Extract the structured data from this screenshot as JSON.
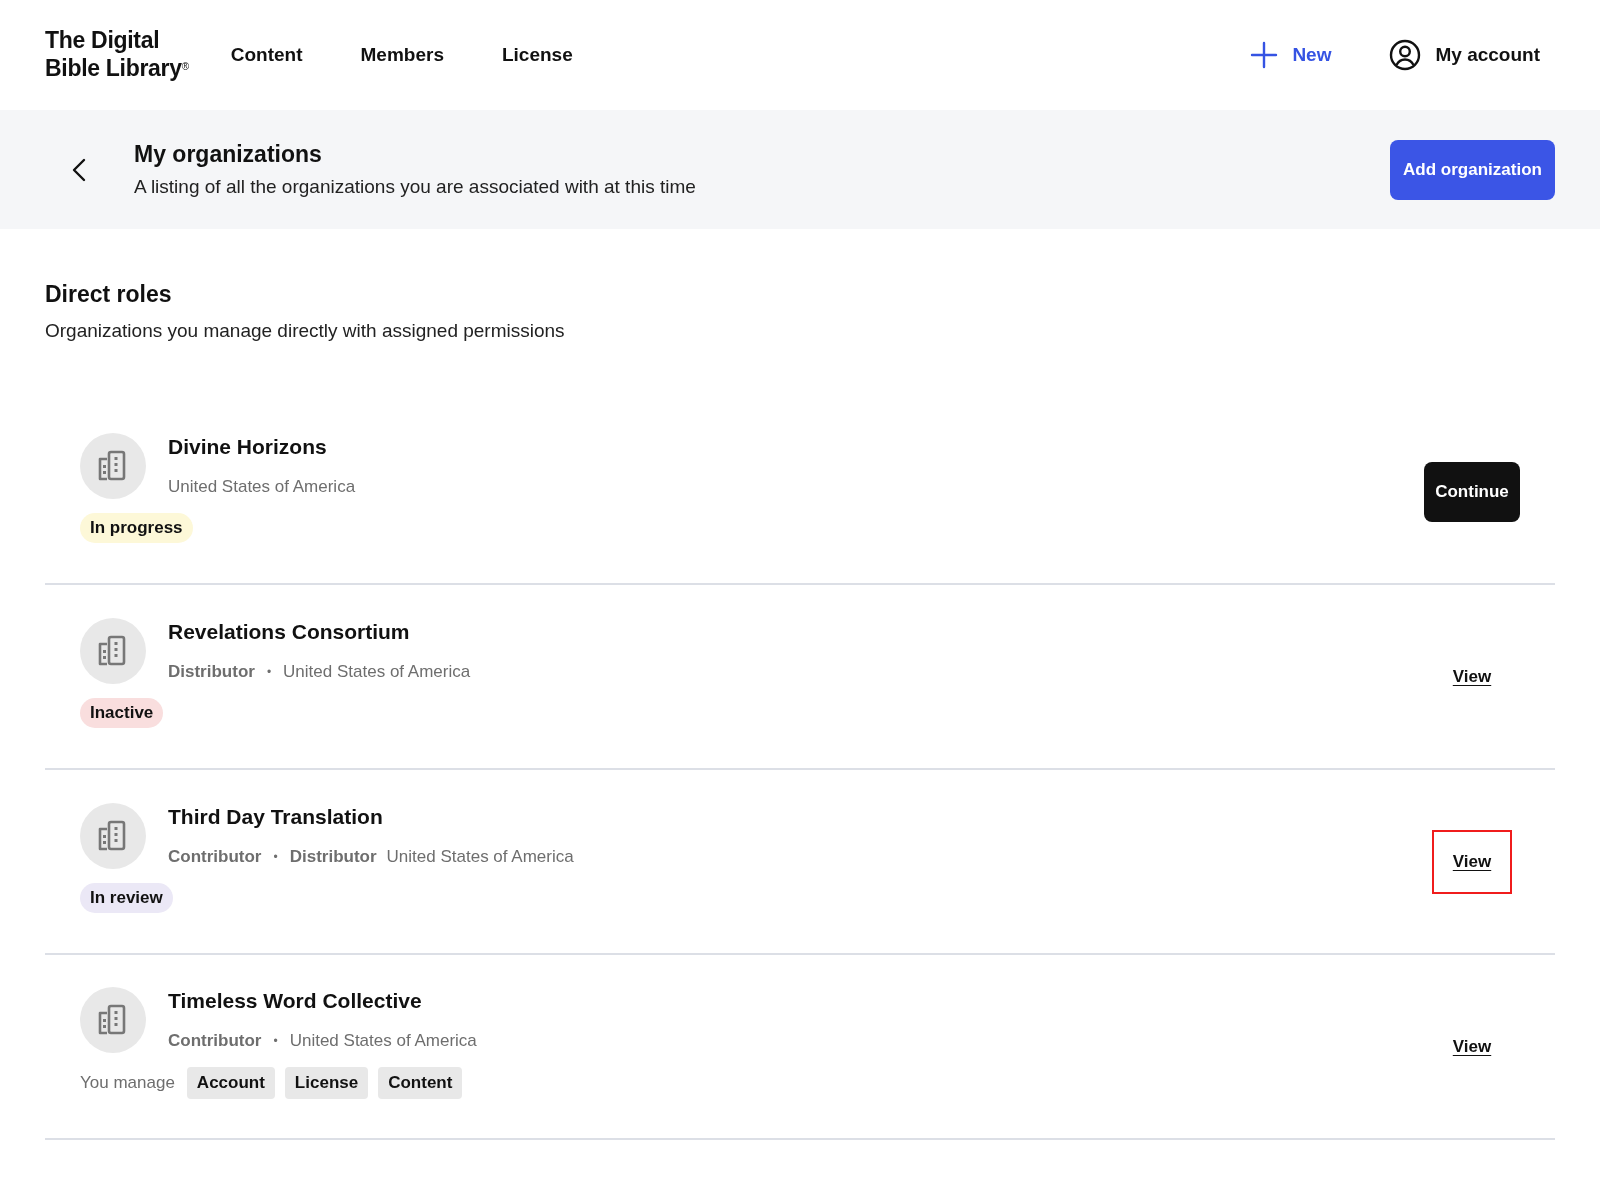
{
  "header": {
    "logo": {
      "line_1": "The Digital",
      "line_2": "Bible Library",
      "mark": "®"
    },
    "nav": [
      {
        "label": "Content"
      },
      {
        "label": "Members"
      },
      {
        "label": "License"
      }
    ],
    "new_button": {
      "label": "New"
    },
    "account_button": {
      "label": "My account"
    }
  },
  "banner": {
    "title": "My organizations",
    "subtitle": "A listing of all the organizations you are associated with at this time",
    "action": {
      "label": "Add organization"
    }
  },
  "section": {
    "title": "Direct roles",
    "subtitle": "Organizations you manage directly with assigned permissions",
    "organizations": [
      {
        "name": "Divine Horizons",
        "meta": [
          {
            "kind": "country",
            "text": "United States of America"
          }
        ],
        "status": {
          "label": "In progress",
          "color": "#fdf8d8"
        },
        "action": {
          "kind": "button",
          "label": "Continue",
          "highlighted": false
        }
      },
      {
        "name": "Revelations Consortium",
        "meta": [
          {
            "kind": "role",
            "text": "Distributor"
          },
          {
            "kind": "separator",
            "text": "•"
          },
          {
            "kind": "country",
            "text": "United States of America"
          }
        ],
        "status": {
          "label": "Inactive",
          "color": "#f9dede"
        },
        "action": {
          "kind": "link",
          "label": "View",
          "highlighted": false
        }
      },
      {
        "name": "Third Day Translation",
        "meta": [
          {
            "kind": "role",
            "text": "Contributor"
          },
          {
            "kind": "separator",
            "text": "•"
          },
          {
            "kind": "role",
            "text": "Distributor"
          },
          {
            "kind": "country",
            "text": "United States of America"
          }
        ],
        "status": {
          "label": "In review",
          "color": "#ebe8f6"
        },
        "action": {
          "kind": "link",
          "label": "View",
          "highlighted": true
        }
      },
      {
        "name": "Timeless Word Collective",
        "meta": [
          {
            "kind": "role",
            "text": "Contributor"
          },
          {
            "kind": "separator",
            "text": "•"
          },
          {
            "kind": "country",
            "text": "United States of America"
          }
        ],
        "manage": {
          "label": "You manage",
          "items": [
            {
              "label": "Account"
            },
            {
              "label": "License"
            },
            {
              "label": "Content"
            }
          ]
        },
        "action": {
          "kind": "link",
          "label": "View",
          "highlighted": false
        }
      }
    ]
  }
}
